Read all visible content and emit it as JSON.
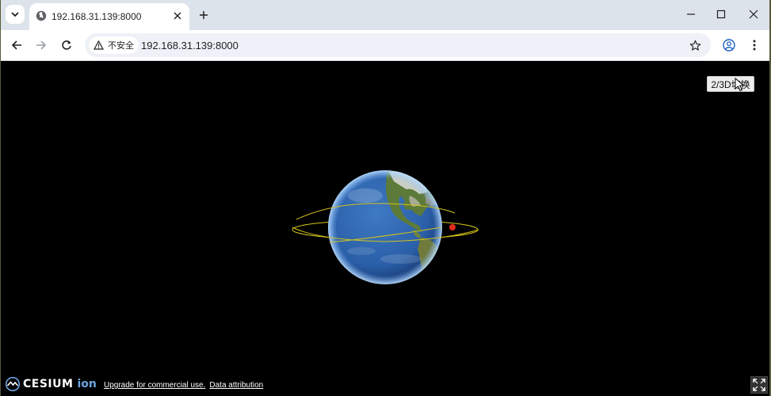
{
  "tab": {
    "title": "192.168.31.139:8000"
  },
  "omnibox": {
    "security_label": "不安全",
    "url": "192.168.31.139:8000"
  },
  "viewer": {
    "switch_button_label": "2/3D切换"
  },
  "credits": {
    "brand": "CESIUM",
    "brand_suffix": "ion",
    "upgrade_link": "Upgrade for commercial use.",
    "attribution_link": "Data attribution"
  },
  "icons": {
    "tab_search": "chevron-down-icon",
    "favicon": "globe-icon",
    "tab_close": "close-icon",
    "new_tab": "plus-icon",
    "minimize": "minimize-icon",
    "maximize": "maximize-icon",
    "close_window": "close-icon",
    "back": "back-arrow-icon",
    "forward": "forward-arrow-icon",
    "reload": "reload-icon",
    "warning": "warning-icon",
    "bookmark": "star-icon",
    "profile": "profile-icon",
    "menu": "kebab-menu-icon",
    "fullscreen": "fullscreen-icon"
  },
  "colors": {
    "orbit": "#d4c21a",
    "satellite": "#e52b1c",
    "ocean": "#2a5fa8",
    "viewer_background": "#000000"
  }
}
